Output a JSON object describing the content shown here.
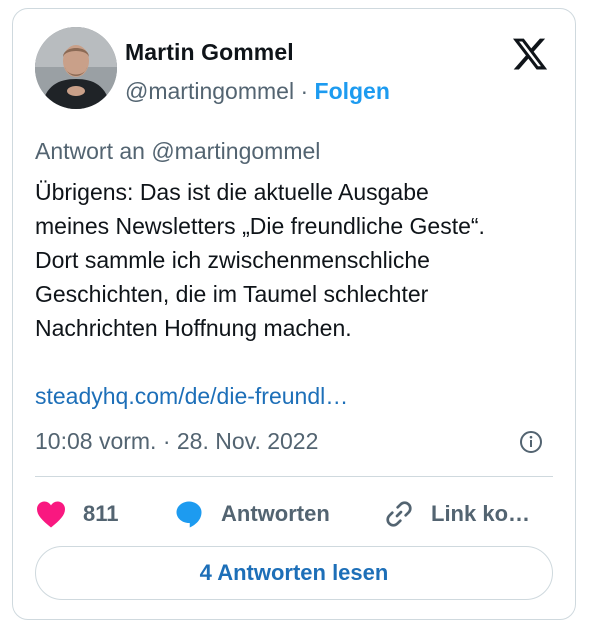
{
  "author": {
    "name": "Martin Gommel",
    "handle": "@martingommel",
    "separator": "·",
    "follow_label": "Folgen"
  },
  "tweet": {
    "reply_to": "Antwort an @martingommel",
    "lines": [
      "Übrigens: Das ist die aktuelle Ausgabe",
      "meines Newsletters „Die freundliche Geste“.",
      "Dort sammle ich zwischenmenschliche",
      "Geschichten, die im Taumel schlechter",
      "Nachrichten Hoffnung machen."
    ],
    "link": "steadyhq.com/de/die-freundl…",
    "timestamp": "10:08 vorm. · 28. Nov. 2022"
  },
  "actions": {
    "like_count": "811",
    "reply_label": "Antworten",
    "copy_link_label": "Link ko…"
  },
  "read_replies_label": "4 Antworten lesen",
  "icons": {
    "brand": "x-logo-icon",
    "info": "info-icon",
    "like": "heart-icon",
    "reply": "speech-bubble-icon",
    "link": "link-icon"
  },
  "colors": {
    "accent": "#1d9bf0",
    "link": "#1d6fb8",
    "like": "#f91880",
    "muted": "#536471",
    "border": "#cfd9de"
  }
}
